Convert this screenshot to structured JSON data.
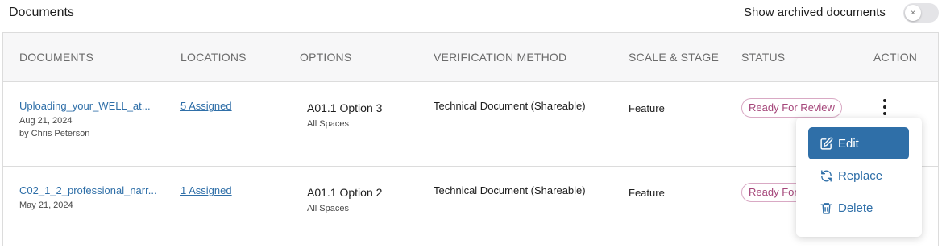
{
  "header": {
    "title": "Documents",
    "archived_toggle_label": "Show archived documents",
    "archived_toggle_on": false,
    "toggle_glyph": "×"
  },
  "table": {
    "columns": [
      "DOCUMENTS",
      "LOCATIONS",
      "OPTIONS",
      "VERIFICATION METHOD",
      "SCALE & STAGE",
      "STATUS",
      "ACTION"
    ],
    "rows": [
      {
        "document": "Uploading_your_WELL_at...",
        "date": "Aug 21, 2024",
        "author": "by Chris Peterson",
        "locations": "5 Assigned",
        "option": "A01.1  Option 3",
        "option_scope": "All Spaces",
        "verification": "Technical Document (Shareable)",
        "scale": "Feature",
        "status": "Ready For Review"
      },
      {
        "document": "C02_1_2_professional_narr...",
        "date": "May 21, 2024",
        "author": "",
        "locations": "1 Assigned",
        "option": "A01.1  Option 2",
        "option_scope": "All Spaces",
        "verification": "Technical Document (Shareable)",
        "scale": "Feature",
        "status": "Ready For Review"
      }
    ]
  },
  "action_menu": {
    "items": [
      {
        "label": "Edit",
        "icon": "edit-icon",
        "active": true
      },
      {
        "label": "Replace",
        "icon": "replace-icon",
        "active": false
      },
      {
        "label": "Delete",
        "icon": "trash-icon",
        "active": false
      }
    ]
  },
  "colors": {
    "link": "#2f6fa8",
    "status_text": "#a5467a",
    "status_border": "#d9a9c4",
    "menu_active_bg": "#2f6fa8",
    "header_bg": "#f7f7f8"
  }
}
